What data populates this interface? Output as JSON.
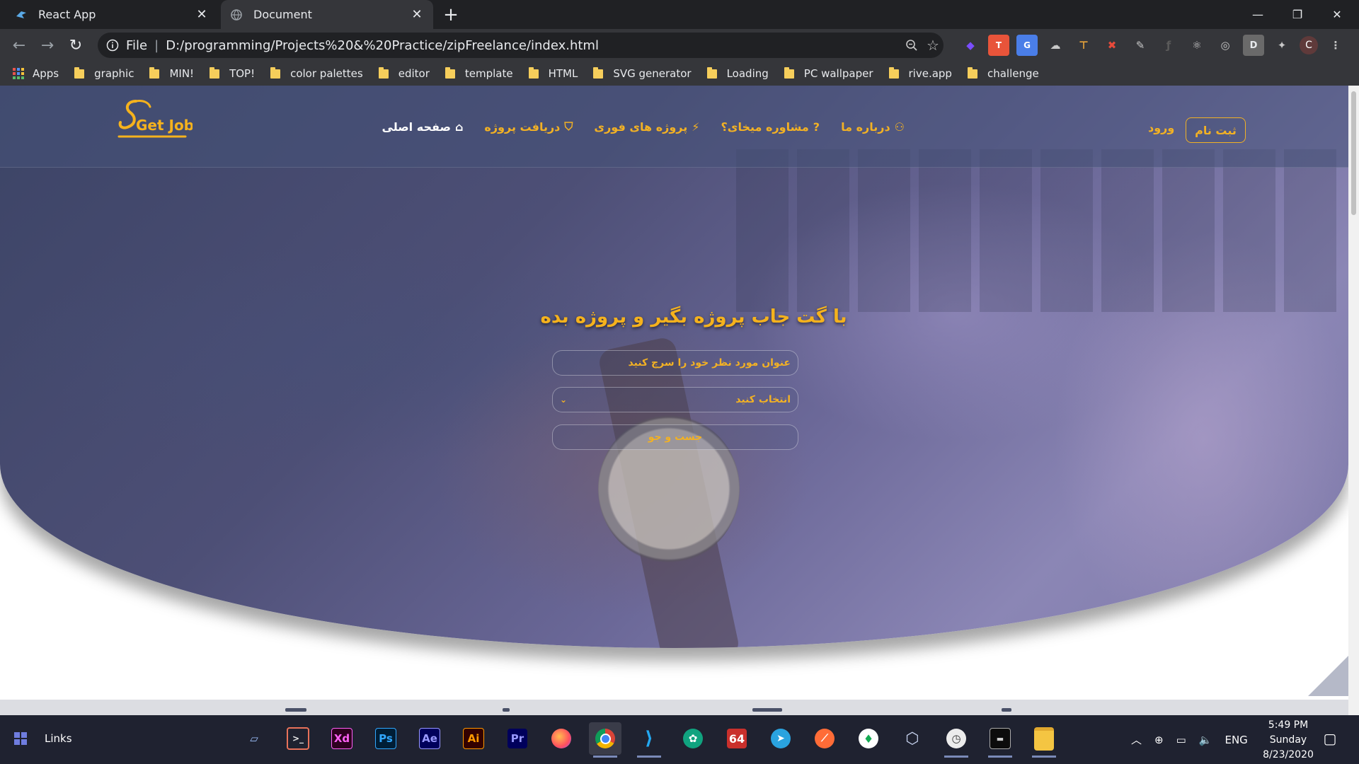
{
  "browser": {
    "tabs": [
      {
        "title": "React App",
        "icon": "react-icon",
        "active": false
      },
      {
        "title": "Document",
        "icon": "globe-icon",
        "active": true
      }
    ],
    "address": {
      "scheme": "File",
      "url": "D:/programming/Projects%20&%20Practice/zipFreelance/index.html"
    },
    "profile_initial": "C",
    "extension_badge": "D",
    "bookmarks": [
      {
        "label": "Apps",
        "type": "apps"
      },
      {
        "label": "graphic",
        "type": "folder"
      },
      {
        "label": "MIN!",
        "type": "folder"
      },
      {
        "label": "TOP!",
        "type": "folder"
      },
      {
        "label": "color palettes",
        "type": "folder"
      },
      {
        "label": "editor",
        "type": "folder"
      },
      {
        "label": "template",
        "type": "folder"
      },
      {
        "label": "HTML",
        "type": "folder"
      },
      {
        "label": "SVG generator",
        "type": "folder"
      },
      {
        "label": "Loading",
        "type": "folder"
      },
      {
        "label": "PC wallpaper",
        "type": "folder"
      },
      {
        "label": "rive.app",
        "type": "folder"
      },
      {
        "label": "challenge",
        "type": "folder"
      }
    ]
  },
  "site": {
    "logo_text": "Get Job",
    "nav": [
      {
        "label": "صفحه اصلی",
        "icon": "home-icon"
      },
      {
        "label": "دریافت پروژه",
        "icon": "shield-icon"
      },
      {
        "label": "پروژه های فوری",
        "icon": "bolt-icon"
      },
      {
        "label": "مشاوره میخای؟",
        "icon": "question-circle-icon"
      },
      {
        "label": "درباره ما",
        "icon": "users-icon"
      }
    ],
    "login": "ورود",
    "signup": "ثبت نام",
    "hero_title": "با گت جاب پروژه بگیر و پروژه بده",
    "search_placeholder": "عنوان مورد نظر خود را سرچ کنید",
    "select_value": "انتخاب کنید",
    "search_button": "جست و جو",
    "accent_color": "#f2b124"
  },
  "taskbar": {
    "links_label": "Links",
    "apps": [
      {
        "name": "laptop-icon",
        "label": ""
      },
      {
        "name": "terminal-icon",
        "label": ">_"
      },
      {
        "name": "xd-icon",
        "label": "Xd"
      },
      {
        "name": "photoshop-icon",
        "label": "Ps"
      },
      {
        "name": "after-effects-icon",
        "label": "Ae"
      },
      {
        "name": "illustrator-icon",
        "label": "Ai"
      },
      {
        "name": "premiere-icon",
        "label": "Pr"
      },
      {
        "name": "firefox-icon",
        "label": ""
      },
      {
        "name": "chrome-icon",
        "label": ""
      },
      {
        "name": "vscode-icon",
        "label": ""
      },
      {
        "name": "chatgpt-icon",
        "label": ""
      },
      {
        "name": "app-64-icon",
        "label": "64"
      },
      {
        "name": "telegram-icon",
        "label": ""
      },
      {
        "name": "postman-icon",
        "label": ""
      },
      {
        "name": "leaf-icon",
        "label": ""
      },
      {
        "name": "cube-icon",
        "label": ""
      },
      {
        "name": "clock-app-icon",
        "label": ""
      },
      {
        "name": "console-icon",
        "label": ""
      },
      {
        "name": "folder-icon",
        "label": ""
      }
    ],
    "lang": "ENG",
    "time": "5:49 PM",
    "day": "Sunday",
    "date": "8/23/2020"
  }
}
